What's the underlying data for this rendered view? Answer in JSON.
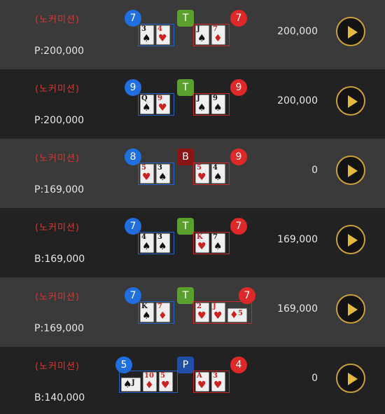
{
  "rows": [
    {
      "commission": "(노커미션)",
      "bet": "P:200,000",
      "amount": "200,000",
      "player_score": "7",
      "banker_score": "7",
      "result": "T",
      "player_cards": [
        {
          "rank": "3",
          "suit": "♠",
          "color": "black"
        },
        {
          "rank": "4",
          "suit": "♥",
          "color": "red"
        }
      ],
      "banker_cards": [
        {
          "rank": "J",
          "suit": "♠",
          "color": "black"
        },
        {
          "rank": "7",
          "suit": "♦",
          "color": "red"
        }
      ]
    },
    {
      "commission": "(노커미션)",
      "bet": "P:200,000",
      "amount": "200,000",
      "player_score": "9",
      "banker_score": "9",
      "result": "T",
      "player_cards": [
        {
          "rank": "Q",
          "suit": "♠",
          "color": "black"
        },
        {
          "rank": "9",
          "suit": "♥",
          "color": "red"
        }
      ],
      "banker_cards": [
        {
          "rank": "J",
          "suit": "♠",
          "color": "black"
        },
        {
          "rank": "9",
          "suit": "♠",
          "color": "black"
        }
      ]
    },
    {
      "commission": "(노커미션)",
      "bet": "P:169,000",
      "amount": "0",
      "player_score": "8",
      "banker_score": "9",
      "result": "B",
      "player_cards": [
        {
          "rank": "5",
          "suit": "♥",
          "color": "red"
        },
        {
          "rank": "3",
          "suit": "♠",
          "color": "black"
        }
      ],
      "banker_cards": [
        {
          "rank": "5",
          "suit": "♥",
          "color": "red"
        },
        {
          "rank": "4",
          "suit": "♠",
          "color": "black"
        }
      ]
    },
    {
      "commission": "(노커미션)",
      "bet": "B:169,000",
      "amount": "169,000",
      "player_score": "7",
      "banker_score": "7",
      "result": "T",
      "player_cards": [
        {
          "rank": "4",
          "suit": "♠",
          "color": "black"
        },
        {
          "rank": "3",
          "suit": "♠",
          "color": "black"
        }
      ],
      "banker_cards": [
        {
          "rank": "K",
          "suit": "♥",
          "color": "red"
        },
        {
          "rank": "7",
          "suit": "♠",
          "color": "black"
        }
      ]
    },
    {
      "commission": "(노커미션)",
      "bet": "P:169,000",
      "amount": "169,000",
      "player_score": "7",
      "banker_score": "7",
      "result": "T",
      "player_cards": [
        {
          "rank": "K",
          "suit": "♠",
          "color": "black"
        },
        {
          "rank": "7",
          "suit": "♦",
          "color": "red"
        }
      ],
      "banker_cards": [
        {
          "rank": "2",
          "suit": "♥",
          "color": "red"
        },
        {
          "rank": "J",
          "suit": "♥",
          "color": "red"
        },
        {
          "rank": "5",
          "suit": "♦",
          "color": "red",
          "side": true
        }
      ]
    },
    {
      "commission": "(노커미션)",
      "bet": "B:140,000",
      "amount": "0",
      "player_score": "5",
      "banker_score": "4",
      "result": "P",
      "player_cards": [
        {
          "rank": "J",
          "suit": "♠",
          "color": "black",
          "side": true
        },
        {
          "rank": "10",
          "suit": "♦",
          "color": "red"
        },
        {
          "rank": "5",
          "suit": "♥",
          "color": "red"
        }
      ],
      "banker_cards": [
        {
          "rank": "A",
          "suit": "♥",
          "color": "red"
        },
        {
          "rank": "3",
          "suit": "♥",
          "color": "red"
        }
      ]
    }
  ]
}
